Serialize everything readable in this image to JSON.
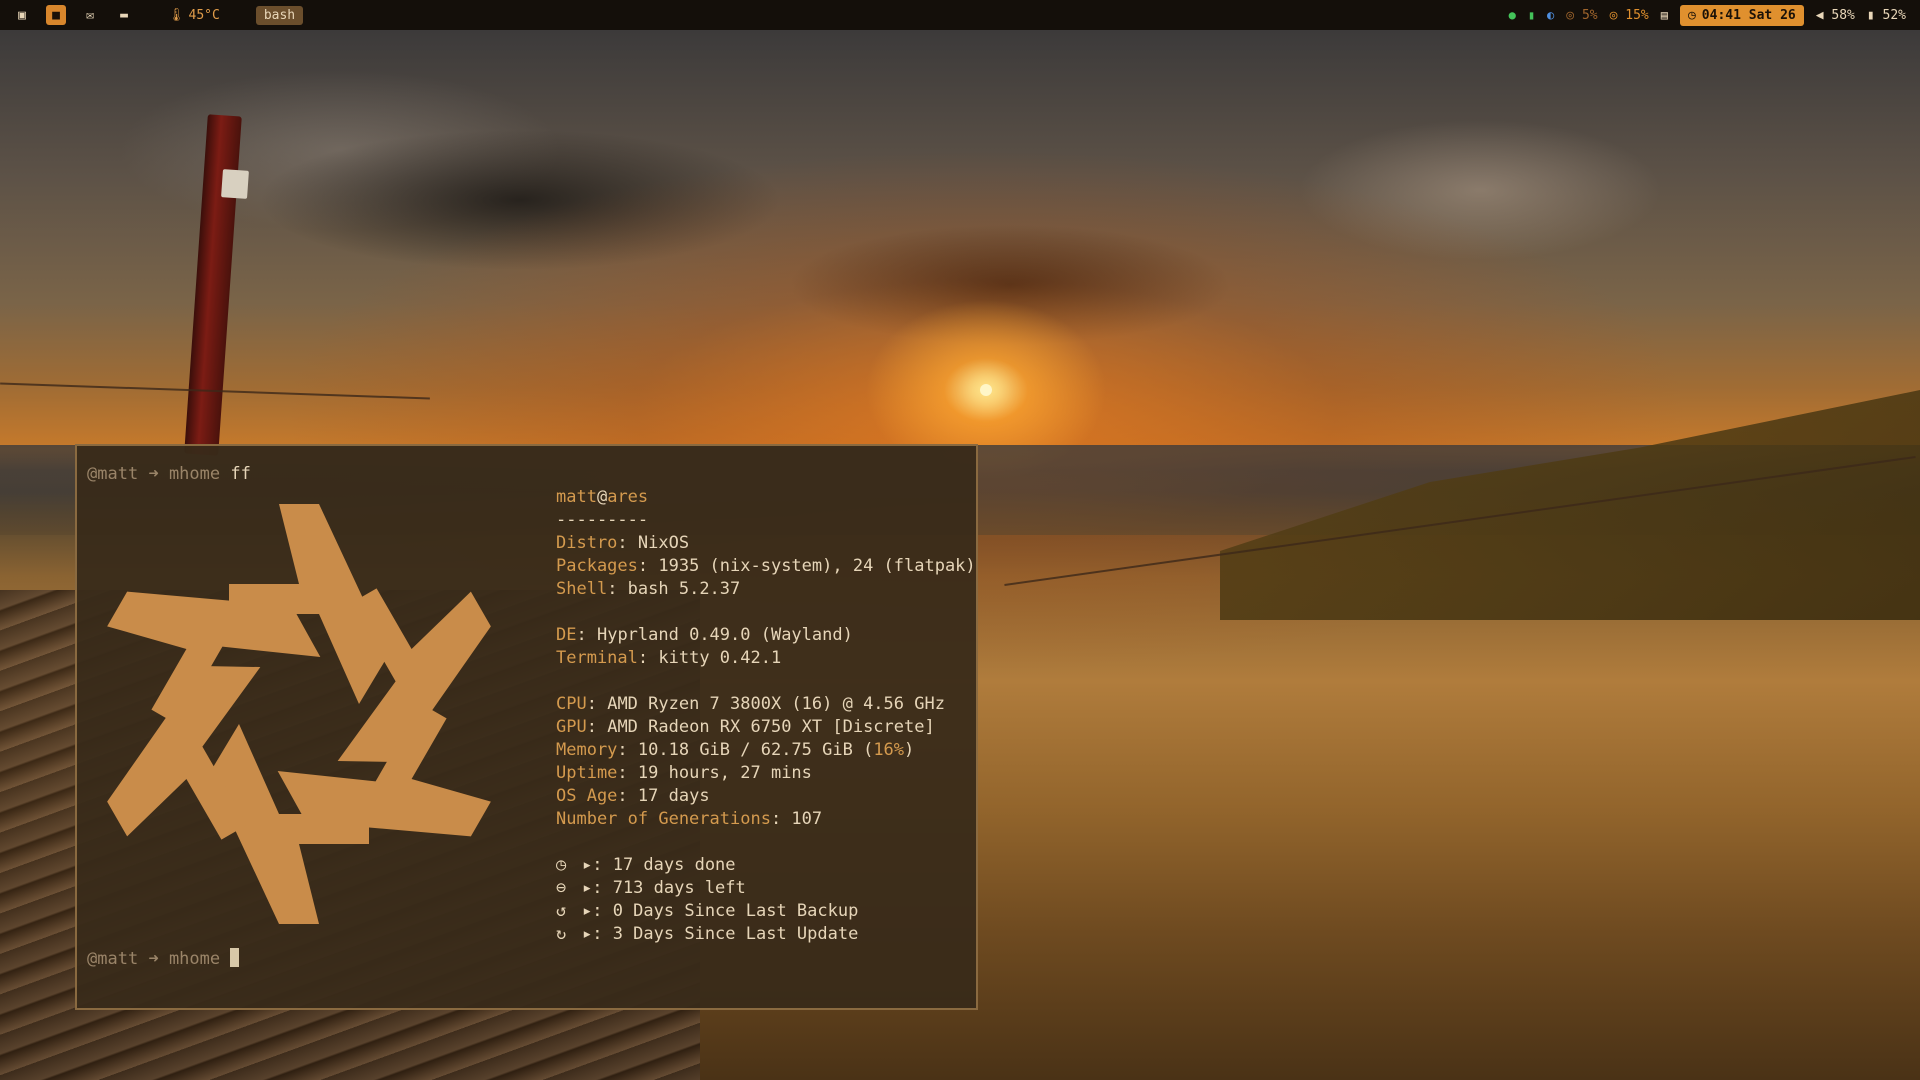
{
  "topbar": {
    "workspaces": [
      {
        "icon": "terminal-icon",
        "glyph": "▣",
        "active": false
      },
      {
        "icon": "folder-icon",
        "glyph": "■",
        "active": true
      },
      {
        "icon": "mail-icon",
        "glyph": "✉",
        "active": false
      },
      {
        "icon": "files-icon",
        "glyph": "▬",
        "active": false
      }
    ],
    "temperature": "45°C",
    "active_window": "bash",
    "cpu": "5%",
    "memory": "15%",
    "clock": "04:41 Sat 26",
    "volume": "58%",
    "mic": "52%"
  },
  "terminal": {
    "prompt_user": "@matt",
    "prompt_arrow": "➜",
    "prompt_dir": "mhome",
    "command": "ff",
    "logo_color": "#c98c4a",
    "info": {
      "user": "matt",
      "at": "@",
      "host": "ares",
      "separator": "---------",
      "rows": [
        {
          "key": "Distro",
          "value": "NixOS"
        },
        {
          "key": "Packages",
          "value": "1935 (nix-system), 24 (flatpak)"
        },
        {
          "key": "Shell",
          "value": "bash 5.2.37"
        },
        {
          "key": "",
          "value": ""
        },
        {
          "key": "DE",
          "value": "Hyprland 0.49.0 (Wayland)"
        },
        {
          "key": "Terminal",
          "value": "kitty 0.42.1"
        },
        {
          "key": "",
          "value": ""
        },
        {
          "key": "CPU",
          "value": "AMD Ryzen 7 3800X (16) @ 4.56 GHz"
        },
        {
          "key": "GPU",
          "value": "AMD Radeon RX 6750 XT [Discrete]"
        },
        {
          "key": "Memory",
          "value_before": "10.18 GiB / 62.75 GiB (",
          "value_hl": "16%",
          "value_after": ")"
        },
        {
          "key": "Uptime",
          "value": "19 hours, 27 mins"
        },
        {
          "key": "OS Age",
          "value": "17 days"
        },
        {
          "key": "Number of Generations",
          "value": "107"
        }
      ],
      "custom": [
        {
          "icon": "clock-icon",
          "glyph": "◷",
          "text": "▸: 17 days done"
        },
        {
          "icon": "minus-circle-icon",
          "glyph": "⊖",
          "text": "▸: 713 days left"
        },
        {
          "icon": "backup-icon",
          "glyph": "↺",
          "text": "▸: 0 Days Since Last Backup"
        },
        {
          "icon": "update-icon",
          "glyph": "↻",
          "text": "▸: 3 Days Since Last Update"
        }
      ]
    }
  }
}
